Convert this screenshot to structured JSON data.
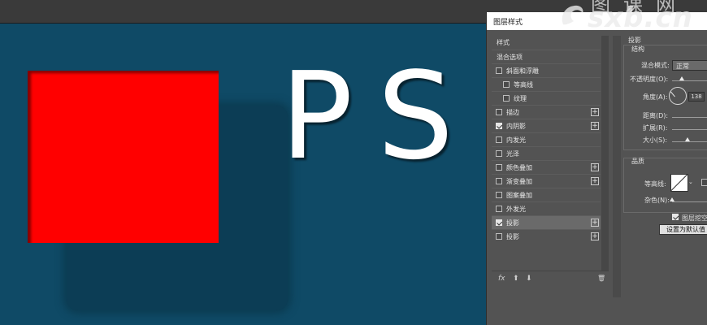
{
  "canvas": {
    "headline": "PS"
  },
  "dialog": {
    "title": "图层样式",
    "styles_header": "样式",
    "blend_options": "混合选项",
    "effects": [
      {
        "label": "斜面和浮雕",
        "checked": false,
        "plus": false,
        "indent": false
      },
      {
        "label": "等高线",
        "checked": false,
        "plus": false,
        "indent": true
      },
      {
        "label": "纹理",
        "checked": false,
        "plus": false,
        "indent": true
      },
      {
        "label": "描边",
        "checked": false,
        "plus": true,
        "indent": false
      },
      {
        "label": "内阴影",
        "checked": true,
        "plus": true,
        "indent": false
      },
      {
        "label": "内发光",
        "checked": false,
        "plus": false,
        "indent": false
      },
      {
        "label": "光泽",
        "checked": false,
        "plus": false,
        "indent": false
      },
      {
        "label": "颜色叠加",
        "checked": false,
        "plus": true,
        "indent": false
      },
      {
        "label": "渐变叠加",
        "checked": false,
        "plus": true,
        "indent": false
      },
      {
        "label": "图案叠加",
        "checked": false,
        "plus": false,
        "indent": false
      },
      {
        "label": "外发光",
        "checked": false,
        "plus": false,
        "indent": false
      },
      {
        "label": "投影",
        "checked": true,
        "plus": true,
        "indent": false,
        "selected": true
      },
      {
        "label": "投影",
        "checked": false,
        "plus": true,
        "indent": false
      }
    ],
    "plus_symbol": "+",
    "bottom_icons": {
      "fx": "fx",
      "up": "⬆",
      "down": "⬇",
      "trash": "🗑"
    },
    "right": {
      "section_title": "投影",
      "structure_title": "结构",
      "blend_mode_label": "混合模式:",
      "blend_mode_value": "正常",
      "opacity_label": "不透明度(O):",
      "angle_label": "角度(A):",
      "angle_value": "138",
      "distance_label": "距离(D):",
      "spread_label": "扩展(R):",
      "size_label": "大小(S):",
      "quality_title": "品质",
      "contour_label": "等高线:",
      "noise_label": "杂色(N):",
      "knockout_label": "图层挖空",
      "knockout_checked": true,
      "default_button": "设置为默认值"
    }
  },
  "watermark": {
    "text": "sxb.cn",
    "chinese": "图课网"
  }
}
